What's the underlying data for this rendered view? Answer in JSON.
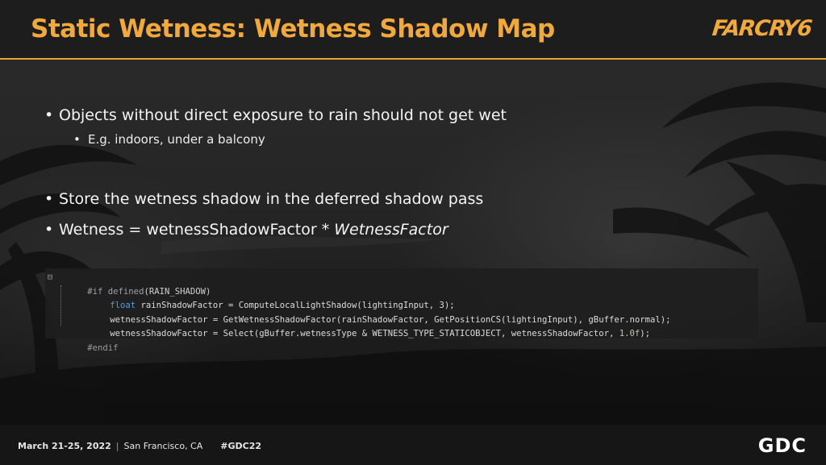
{
  "header": {
    "title": "Static Wetness: Wetness Shadow Map",
    "logo_text": "FARCRY6",
    "accent_color": "#f2a93b"
  },
  "bullets": [
    {
      "text": "Objects without direct exposure to rain should not get wet"
    },
    {
      "text": "E.g. indoors, under a balcony"
    },
    {
      "text": "Store the wetness shadow in the deferred shadow pass"
    },
    {
      "text_prefix": "Wetness = wetnessShadowFactor * ",
      "text_italic": "WetnessFactor"
    }
  ],
  "code": {
    "line1": {
      "gutter": "⊟",
      "kw": "#if ",
      "fn": "defined",
      "arg": "(RAIN_SHADOW)"
    },
    "line2": {
      "type": "float",
      "rest": " rainShadowFactor = ComputeLocalLightShadow(lightingInput, 3);"
    },
    "line3": {
      "rest": "wetnessShadowFactor = GetWetnessShadowFactor(rainShadowFactor, GetPositionCS(lightingInput), gBuffer.normal);"
    },
    "line4": {
      "rest": "wetnessShadowFactor = Select(gBuffer.wetnessType & WETNESS_TYPE_STATICOBJECT, wetnessShadowFactor, ",
      "num": "1.0f",
      "tail": ");"
    },
    "line5": {
      "kw": "#endif"
    }
  },
  "footer": {
    "date": "March 21-25, 2022",
    "separator": "|",
    "location": "San Francisco, CA",
    "hashtag": "#GDC22",
    "logo_text": "GDC"
  }
}
